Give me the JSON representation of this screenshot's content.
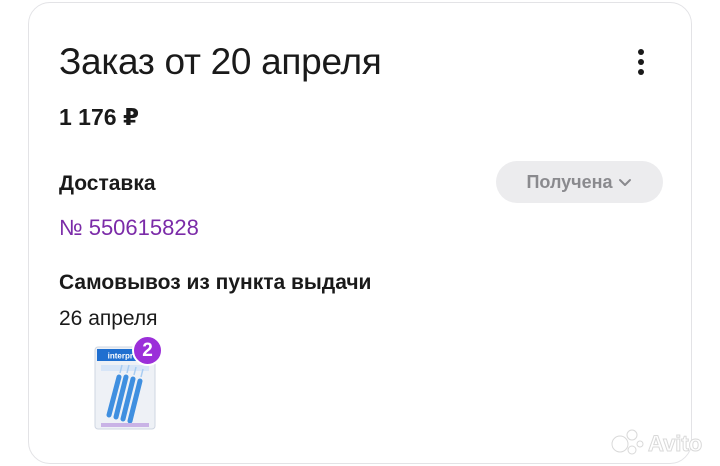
{
  "order": {
    "title": "Заказ от 20 апреля",
    "price": "1 176 ₽",
    "delivery_label": "Доставка",
    "status": "Получена",
    "order_number": "№ 550615828",
    "pickup_label": "Самовывоз из пункта выдачи",
    "pickup_date": "26 апреля"
  },
  "product": {
    "brand_text": "interprox",
    "quantity_badge": "2"
  },
  "icons": {
    "menu": "kebab-menu-icon",
    "status_chevron": "chevron-down-icon",
    "watermark": "avito-logo"
  },
  "colors": {
    "order_number": "#7b2ba8",
    "badge": "#9b2fd9",
    "status_bg": "#ececee",
    "status_text": "#8a8a8e"
  }
}
